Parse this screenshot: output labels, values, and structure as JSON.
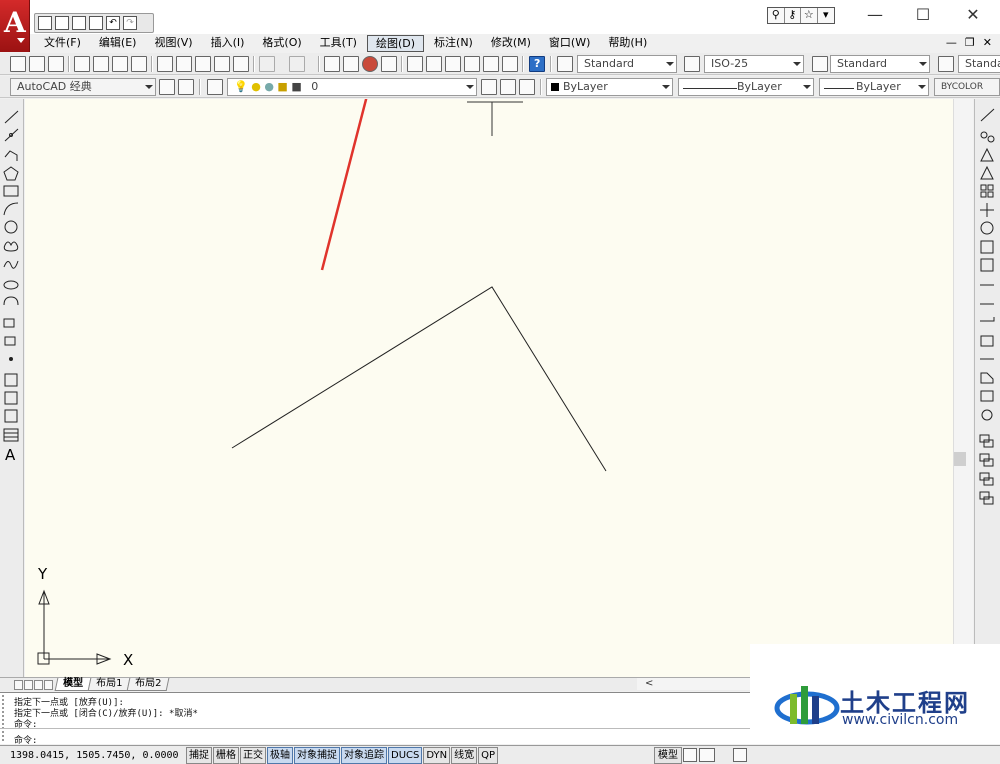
{
  "app": {
    "logo_letter": "A"
  },
  "menu": {
    "items": [
      {
        "label": "文件(F)"
      },
      {
        "label": "编辑(E)"
      },
      {
        "label": "视图(V)"
      },
      {
        "label": "插入(I)"
      },
      {
        "label": "格式(O)"
      },
      {
        "label": "工具(T)"
      },
      {
        "label": "绘图(D)"
      },
      {
        "label": "标注(N)"
      },
      {
        "label": "修改(M)"
      },
      {
        "label": "窗口(W)"
      },
      {
        "label": "帮助(H)"
      }
    ],
    "active_index": 6
  },
  "toolbar": {
    "text_style": "Standard",
    "dim_style": "ISO-25",
    "table_style": "Standard",
    "multileader_style": "Standa"
  },
  "toolbar2": {
    "workspace": "AutoCAD 经典",
    "layer": "0",
    "color": "ByLayer",
    "linetype": "ByLayer",
    "lineweight": "ByLayer",
    "plotstyle": "BYCOLOR"
  },
  "ucs": {
    "x_label": "X",
    "y_label": "Y"
  },
  "tabs": {
    "items": [
      {
        "label": "模型"
      },
      {
        "label": "布局1"
      },
      {
        "label": "布局2"
      }
    ],
    "active_index": 0
  },
  "command": {
    "history": [
      "指定下一点或 [放弃(U)]:",
      "指定下一点或 [闭合(C)/放弃(U)]: *取消*",
      "命令:"
    ],
    "prompt": "命令:"
  },
  "status": {
    "coords": "1398.0415, 1505.7450, 0.0000",
    "toggles": [
      {
        "label": "捕捉",
        "on": false
      },
      {
        "label": "栅格",
        "on": false
      },
      {
        "label": "正交",
        "on": false
      },
      {
        "label": "极轴",
        "on": true
      },
      {
        "label": "对象捕捉",
        "on": true
      },
      {
        "label": "对象追踪",
        "on": true
      },
      {
        "label": "DUCS",
        "on": true
      },
      {
        "label": "DYN",
        "on": false
      },
      {
        "label": "线宽",
        "on": false
      },
      {
        "label": "QP",
        "on": false
      }
    ],
    "model_label": "模型"
  },
  "watermark": {
    "name": "土木工程网",
    "url": "www.civilcn.com"
  },
  "colors": {
    "canvas_bg": "#fdfcf1",
    "logo_red": "#c82020",
    "arrow_red": "#e0342c",
    "toggle_on": "#c9daf0"
  },
  "icons": [
    "search-icon",
    "key-icon",
    "star-icon",
    "zoom-window-icon",
    "help-icon",
    "polyline-icon",
    "circle-icon",
    "rectangle-icon",
    "move-icon",
    "rotate-icon",
    "text-icon"
  ]
}
